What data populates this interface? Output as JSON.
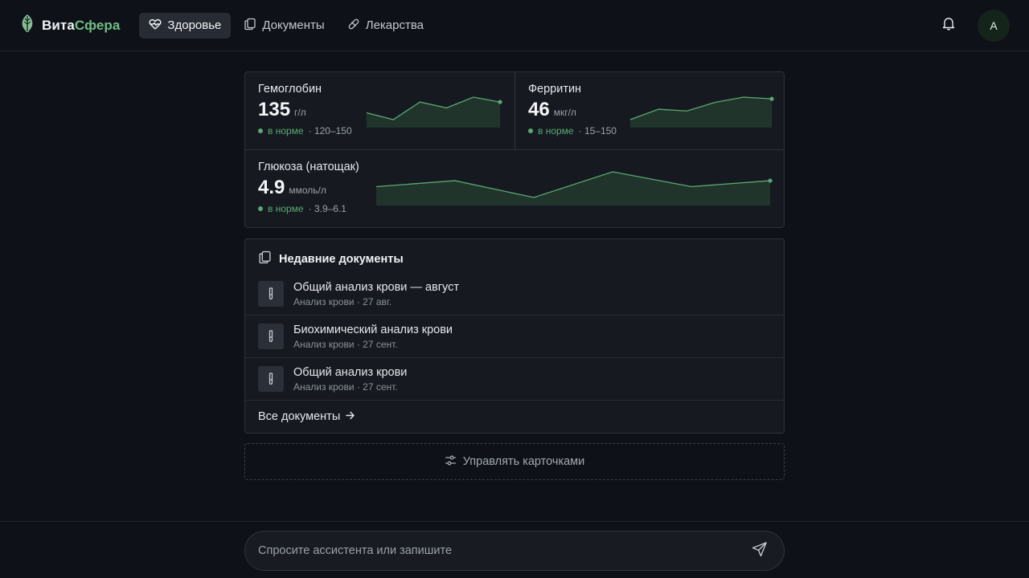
{
  "app": {
    "logo_part1": "Вита",
    "logo_part2": "Сфера",
    "logo_icon": "leaf-icon",
    "accent": "#6fbf85"
  },
  "nav": [
    {
      "label": "Здоровье",
      "icon": "heart-pulse-icon",
      "active": true
    },
    {
      "label": "Документы",
      "icon": "documents-icon",
      "active": false
    },
    {
      "label": "Лекарства",
      "icon": "pill-icon",
      "active": false
    }
  ],
  "header": {
    "bell_icon": "bell-icon",
    "avatar_letter": "А"
  },
  "metrics": [
    {
      "name": "Гемоглобин",
      "value": "135",
      "unit": "г/л",
      "status": "в норме",
      "range": "· 120–150",
      "trend": [
        0.45,
        0.1,
        1.0,
        0.7,
        1.25,
        1.0
      ]
    },
    {
      "name": "Ферритин",
      "value": "46",
      "unit": "мкг/л",
      "status": "в норме",
      "range": "· 15–150",
      "trend": [
        0.0,
        0.6,
        0.5,
        1.0,
        1.3,
        1.2
      ]
    },
    {
      "name": "Глюкоза (натощак)",
      "value": "4.9",
      "unit": "ммоль/л",
      "status": "в норме",
      "range": "· 3.9–6.1",
      "trend": [
        0.55,
        0.85,
        0.0,
        1.3,
        0.55,
        0.85
      ]
    }
  ],
  "status_color": "#5aa874",
  "documents": {
    "title": "Недавние документы",
    "icon": "documents-icon",
    "items": [
      {
        "name": "Общий анализ крови — август",
        "meta": "Анализ крови · 27 авг.",
        "icon": "test-tube-icon"
      },
      {
        "name": "Биохимический анализ крови",
        "meta": "Анализ крови · 27 сент.",
        "icon": "test-tube-icon"
      },
      {
        "name": "Общий анализ крови",
        "meta": "Анализ крови · 27 сент.",
        "icon": "test-tube-icon"
      }
    ],
    "all_label": "Все документы",
    "all_icon": "arrow-right-icon"
  },
  "manage": {
    "label": "Управлять карточками",
    "icon": "sliders-icon"
  },
  "chat": {
    "placeholder": "Спросите ассистента или запишите",
    "send_icon": "send-icon"
  }
}
